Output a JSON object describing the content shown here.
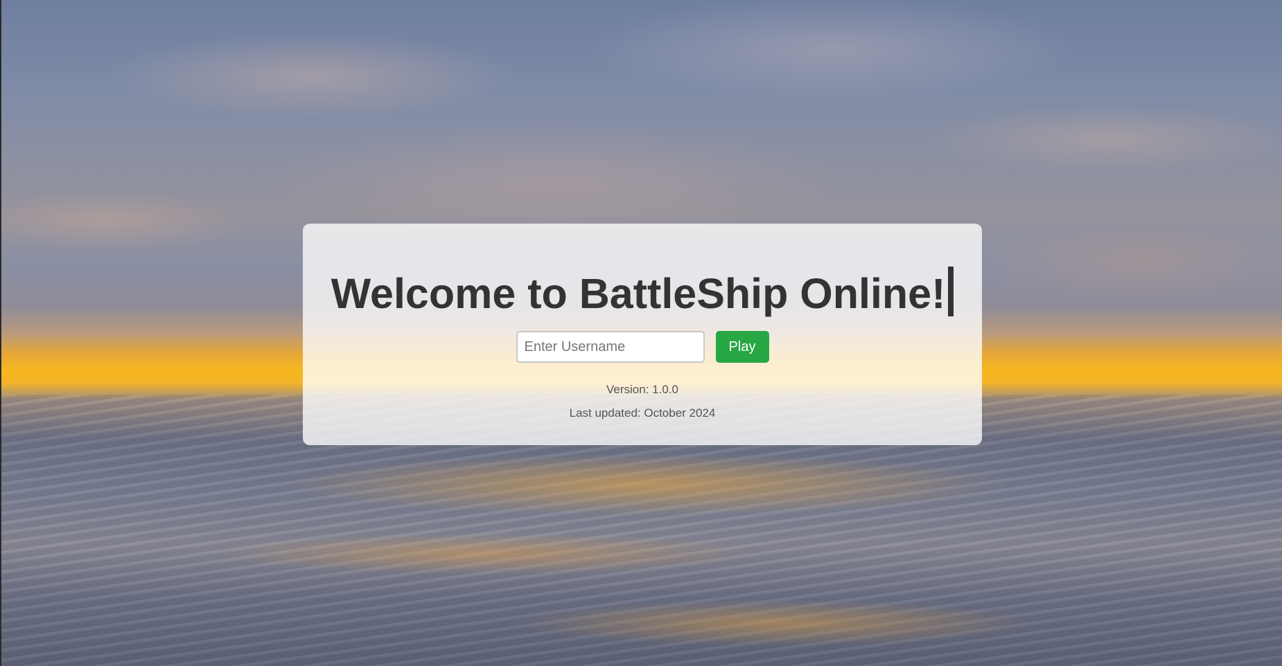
{
  "welcome": {
    "title": "Welcome to BattleShip Online!"
  },
  "login": {
    "username_placeholder": "Enter Username",
    "username_value": "",
    "play_label": "Play"
  },
  "footer": {
    "version": "Version: 1.0.0",
    "last_updated": "Last updated: October 2024"
  },
  "colors": {
    "play_button": "#28a745",
    "title_text": "#333333",
    "card_background": "rgba(255,255,255,0.78)"
  }
}
